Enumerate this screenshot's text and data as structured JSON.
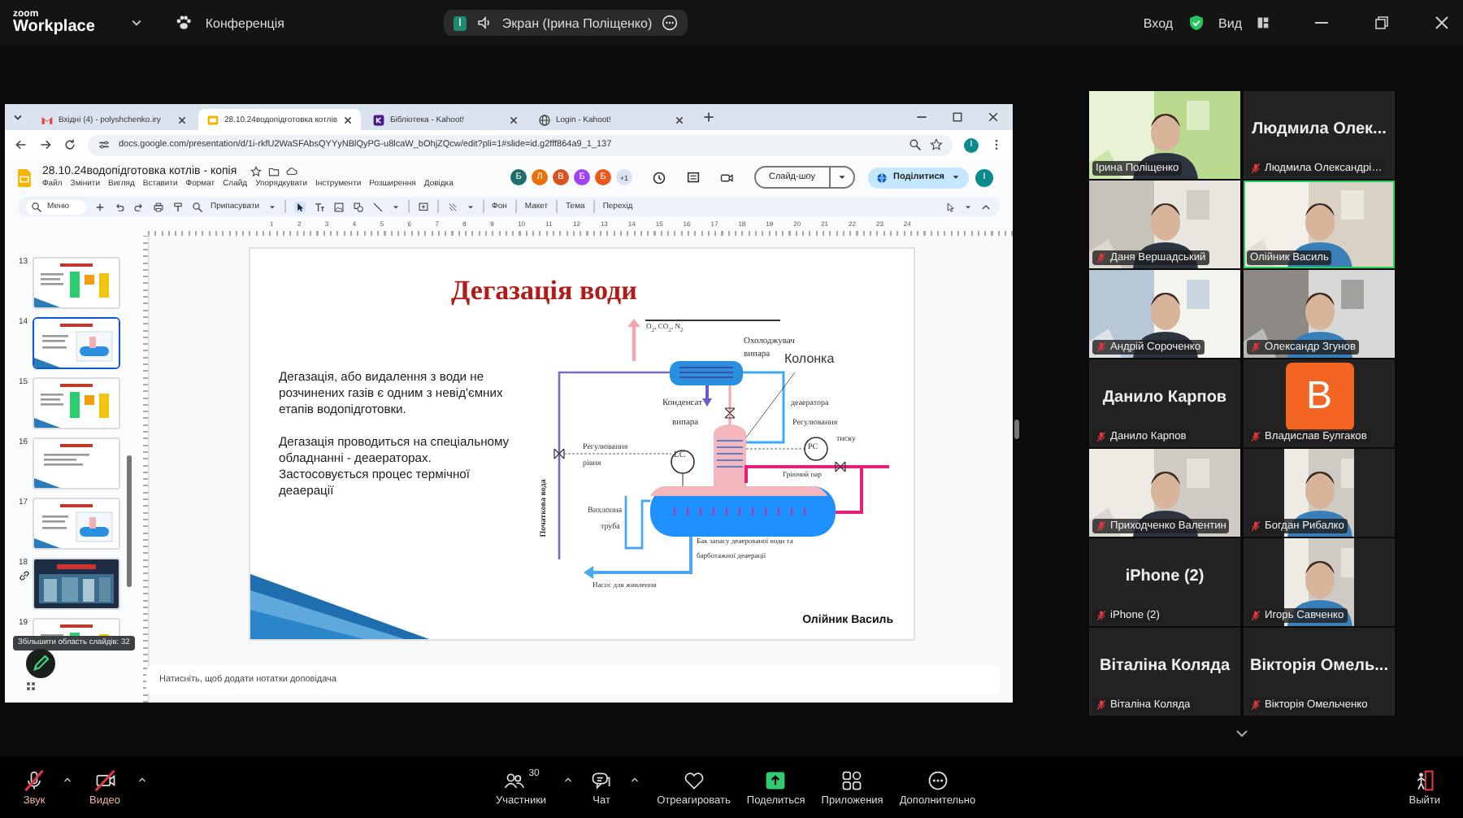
{
  "zoom_bar": {
    "logo_top": "zoom",
    "logo_bottom": "Workplace",
    "meeting_menu": "Конференція",
    "share_badge": "І",
    "share_label": "Экран (Ірина Поліщенко)",
    "sign_in": "Вход",
    "view": "Вид"
  },
  "browser": {
    "tabs": [
      {
        "title": "Вхідні (4) - polyshchenko.iry",
        "kind": "mail",
        "selected": false
      },
      {
        "title": "28.10.24водопідготовка котлів",
        "kind": "slides",
        "selected": true
      },
      {
        "title": "Бібліотека - Kahoot!",
        "kind": "kahoot",
        "selected": false
      },
      {
        "title": "Login - Kahoot!",
        "kind": "globe",
        "selected": false
      }
    ],
    "url": "docs.google.com/presentation/d/1i-rkfU2WaSFAbsQYYyNBlQyPG-u8lcaW_bOhjZQcw/edit?pli=1#slide=id.g2fff864a9_1_137",
    "doc_title": "28.10.24водопідготовка котлів  - копія",
    "menu": [
      "Файл",
      "Змінити",
      "Вигляд",
      "Вставити",
      "Формат",
      "Слайд",
      "Упорядкувати",
      "Інструменти",
      "Розширення",
      "Довідка"
    ],
    "collaborators": [
      {
        "initial": "Б",
        "color": "#1e6f6b"
      },
      {
        "initial": "Л",
        "color": "#e8710a"
      },
      {
        "initial": "В",
        "color": "#d9531e"
      },
      {
        "initial": "Б",
        "color": "#a142f4"
      },
      {
        "initial": "Б",
        "color": "#e8591a"
      }
    ],
    "collaborators_more": "+1",
    "slideshow": "Слайд-шоу",
    "share": "Поділитися",
    "user_initial": "І",
    "account_initial": "І",
    "toolbar": {
      "search": "Меню",
      "zoom": "Припасувати",
      "items": [
        "Фон",
        "Макет",
        "Тема",
        "Перехід"
      ]
    },
    "ruler": [
      "1",
      "2",
      "3",
      "4",
      "5",
      "6",
      "7",
      "8",
      "9",
      "10",
      "11",
      "12",
      "13",
      "14",
      "15",
      "16",
      "17",
      "18",
      "19",
      "20",
      "21",
      "22",
      "23",
      "24"
    ],
    "thumbnails": [
      {
        "number": "13",
        "kind": "slide",
        "selected": false
      },
      {
        "number": "14",
        "kind": "diagram",
        "selected": true
      },
      {
        "number": "15",
        "kind": "slide",
        "selected": false
      },
      {
        "number": "16",
        "kind": "text",
        "selected": false
      },
      {
        "number": "17",
        "kind": "diagram",
        "selected": false
      },
      {
        "number": "18",
        "selected": false
      },
      {
        "number": "19",
        "kind": "slide",
        "selected": false
      }
    ],
    "tooltip": "Збільшити область слайдів: 32",
    "notes_placeholder": "Натисніть, щоб додати нотатки доповідача"
  },
  "slide": {
    "title": "Дегазація води",
    "paragraphs": [
      "Дегазація, або видалення з води не розчинених газів є одним з невід'ємних етапів водопідготовки.",
      "Дегазація проводиться на спеціальному обладнанні - деаераторах. Застосовується процес термічної деаерації"
    ],
    "author": "Олійник Василь",
    "diagram_labels": [
      "O$_{2}$, CO$_{2}$, N$_{2}$",
      "Охолоджувач",
      "випара",
      "Колонка",
      "деаератора",
      "Конденсат",
      "випара",
      "Регулювання",
      "тиску",
      "PC",
      "LC",
      "Регулювання",
      "рівня",
      "Гріючий пар",
      "Вихлопна",
      "труба",
      "Початкова вода",
      "Бак запасу деаерованої води та",
      "барботажної деаерації",
      "Насос для живлення"
    ]
  },
  "participants": [
    {
      "name": "Ірина Поліщенко",
      "kind": "video",
      "muted": false,
      "speaking": false
    },
    {
      "name": "Людмила Олександрі…",
      "kind": "name",
      "big_name": "Людмила  Олек...",
      "muted": true,
      "speaking": false
    },
    {
      "name": "Даня Вершадський",
      "kind": "video",
      "muted": true,
      "speaking": false
    },
    {
      "name": "Олійник Василь",
      "kind": "video",
      "muted": false,
      "speaking": true
    },
    {
      "name": "Андрій Сороченко",
      "kind": "video",
      "muted": true,
      "speaking": false
    },
    {
      "name": "Олександр Згунов",
      "kind": "video",
      "muted": true,
      "speaking": false
    },
    {
      "name": "Данило Карпов",
      "kind": "name",
      "big_name": "Данило Карпов",
      "muted": true,
      "speaking": false
    },
    {
      "name": "Владислав Булгаков",
      "kind": "avatar",
      "initial": "B",
      "color": "#f26522",
      "muted": true,
      "speaking": false
    },
    {
      "name": "Приходченко Валентин",
      "kind": "video",
      "muted": true,
      "speaking": false
    },
    {
      "name": "Богдан Рибалко",
      "muted": true,
      "speaking": false
    },
    {
      "name": "iPhone (2)",
      "kind": "name",
      "big_name": "iPhone (2)",
      "muted": true,
      "speaking": false
    },
    {
      "name": "Игорь Савченко",
      "muted": true,
      "speaking": false
    },
    {
      "name": "Віталіна Коляда",
      "kind": "name",
      "big_name": "Віталіна Коляда",
      "muted": true,
      "speaking": false
    },
    {
      "name": "Вікторія Омельченко",
      "kind": "name",
      "big_name": "Вікторія  Омель...",
      "muted": true,
      "speaking": false
    }
  ],
  "controls": [
    {
      "label": "Звук",
      "kind": "mic",
      "off": true,
      "caret": true
    },
    {
      "label": "Видео",
      "kind": "video",
      "off": true,
      "caret": true
    },
    {
      "label": "Участники",
      "kind": "participants",
      "count": "30",
      "off": false,
      "caret": true
    },
    {
      "label": "Чат",
      "kind": "chat",
      "off": false,
      "caret": true
    },
    {
      "label": "Отреагировать",
      "kind": "react",
      "off": false,
      "caret": false
    },
    {
      "label": "Поделиться",
      "kind": "share",
      "off": false,
      "caret": false
    },
    {
      "label": "Приложения",
      "kind": "apps",
      "off": false,
      "caret": false
    },
    {
      "label": "Дополнительно",
      "kind": "more",
      "off": false,
      "caret": false
    },
    {
      "label": "Выйти",
      "kind": "leave",
      "off": false,
      "caret": false
    }
  ]
}
